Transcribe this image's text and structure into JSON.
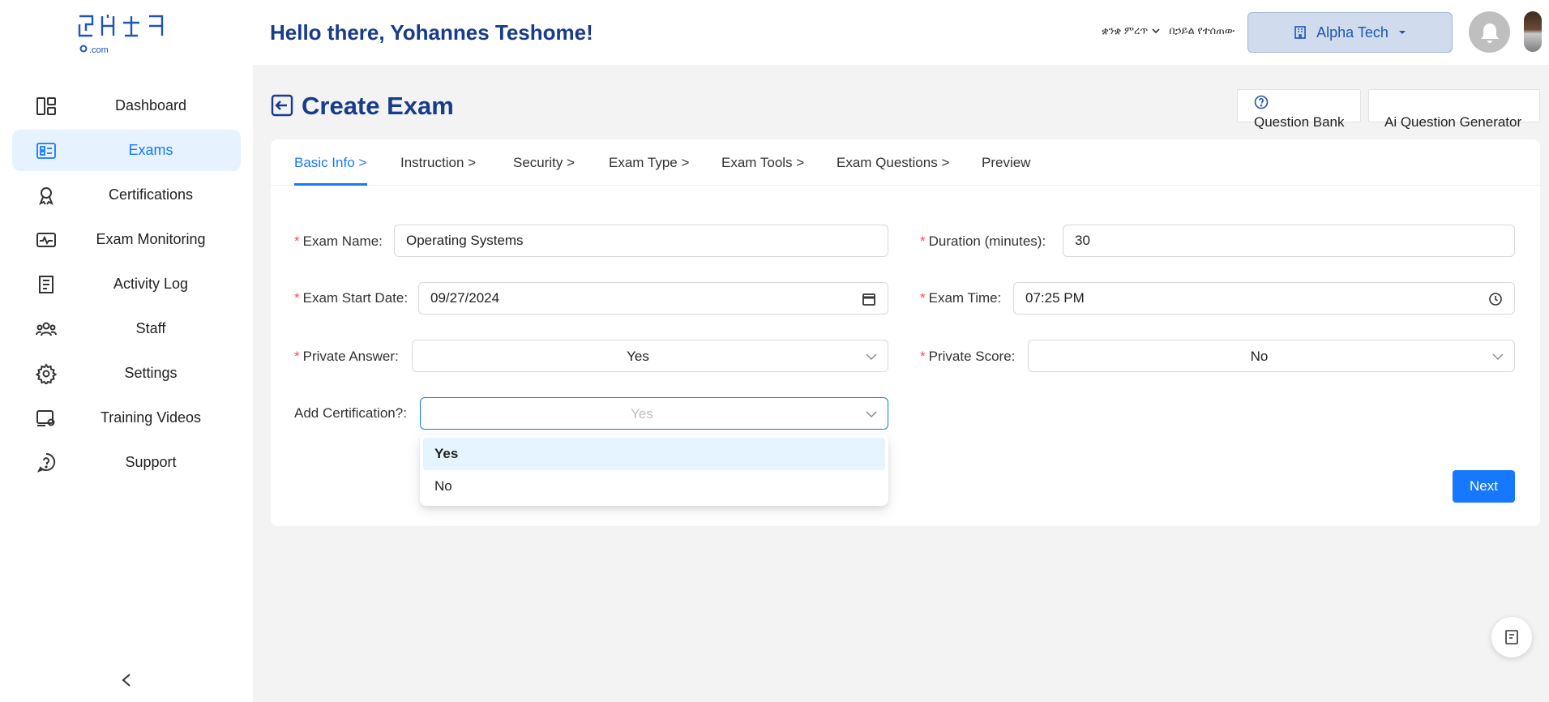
{
  "header": {
    "greeting": "Hello there, Yohannes Teshome!",
    "lang_selector": "ቋንቋ ምረጥ",
    "lang_extra": "በኃይል የተሰጠው",
    "organization": "Alpha Tech"
  },
  "logo": {
    "wordmark": "ፈተና",
    "sub": ".com"
  },
  "sidebar": {
    "items": [
      {
        "label": "Dashboard",
        "icon": "dashboard-icon",
        "active": false
      },
      {
        "label": "Exams",
        "icon": "exams-icon",
        "active": true
      },
      {
        "label": "Certifications",
        "icon": "certificate-icon",
        "active": false
      },
      {
        "label": "Exam Monitoring",
        "icon": "monitoring-icon",
        "active": false
      },
      {
        "label": "Activity Log",
        "icon": "activity-log-icon",
        "active": false
      },
      {
        "label": "Staff",
        "icon": "staff-icon",
        "active": false
      },
      {
        "label": "Settings",
        "icon": "gear-icon",
        "active": false
      },
      {
        "label": "Training Videos",
        "icon": "training-videos-icon",
        "active": false
      },
      {
        "label": "Support",
        "icon": "support-icon",
        "active": false
      }
    ],
    "collapse_label": "<"
  },
  "page": {
    "title": "Create Exam",
    "question_bank": "Question Bank",
    "ai_generator": "Ai Question Generator"
  },
  "tabs": [
    {
      "label": "Basic Info >",
      "active": true
    },
    {
      "label": "Instruction >",
      "active": false
    },
    {
      "label": "Security >",
      "active": false
    },
    {
      "label": "Exam Type >",
      "active": false
    },
    {
      "label": "Exam Tools >",
      "active": false
    },
    {
      "label": "Exam Questions >",
      "active": false
    },
    {
      "label": "Preview",
      "active": false
    }
  ],
  "form": {
    "exam_name": {
      "label": "Exam Name",
      "value": "Operating Systems"
    },
    "duration": {
      "label": "Duration (minutes)",
      "value": "30"
    },
    "start_date": {
      "label": "Exam Start Date",
      "value": "09/27/2024"
    },
    "exam_time": {
      "label": "Exam Time",
      "value": "07:25 PM"
    },
    "private_answer": {
      "label": "Private Answer",
      "value": "Yes"
    },
    "private_score": {
      "label": "Private Score",
      "value": "No"
    },
    "add_certification": {
      "label": "Add Certification?",
      "placeholder": "Yes",
      "options": [
        "Yes",
        "No"
      ],
      "highlighted": "Yes"
    },
    "next_label": "Next"
  },
  "colors": {
    "brand": "#183b8a",
    "primary": "#1677ff",
    "required": "#ff4d4f",
    "active_bg": "#e6f3ff"
  }
}
